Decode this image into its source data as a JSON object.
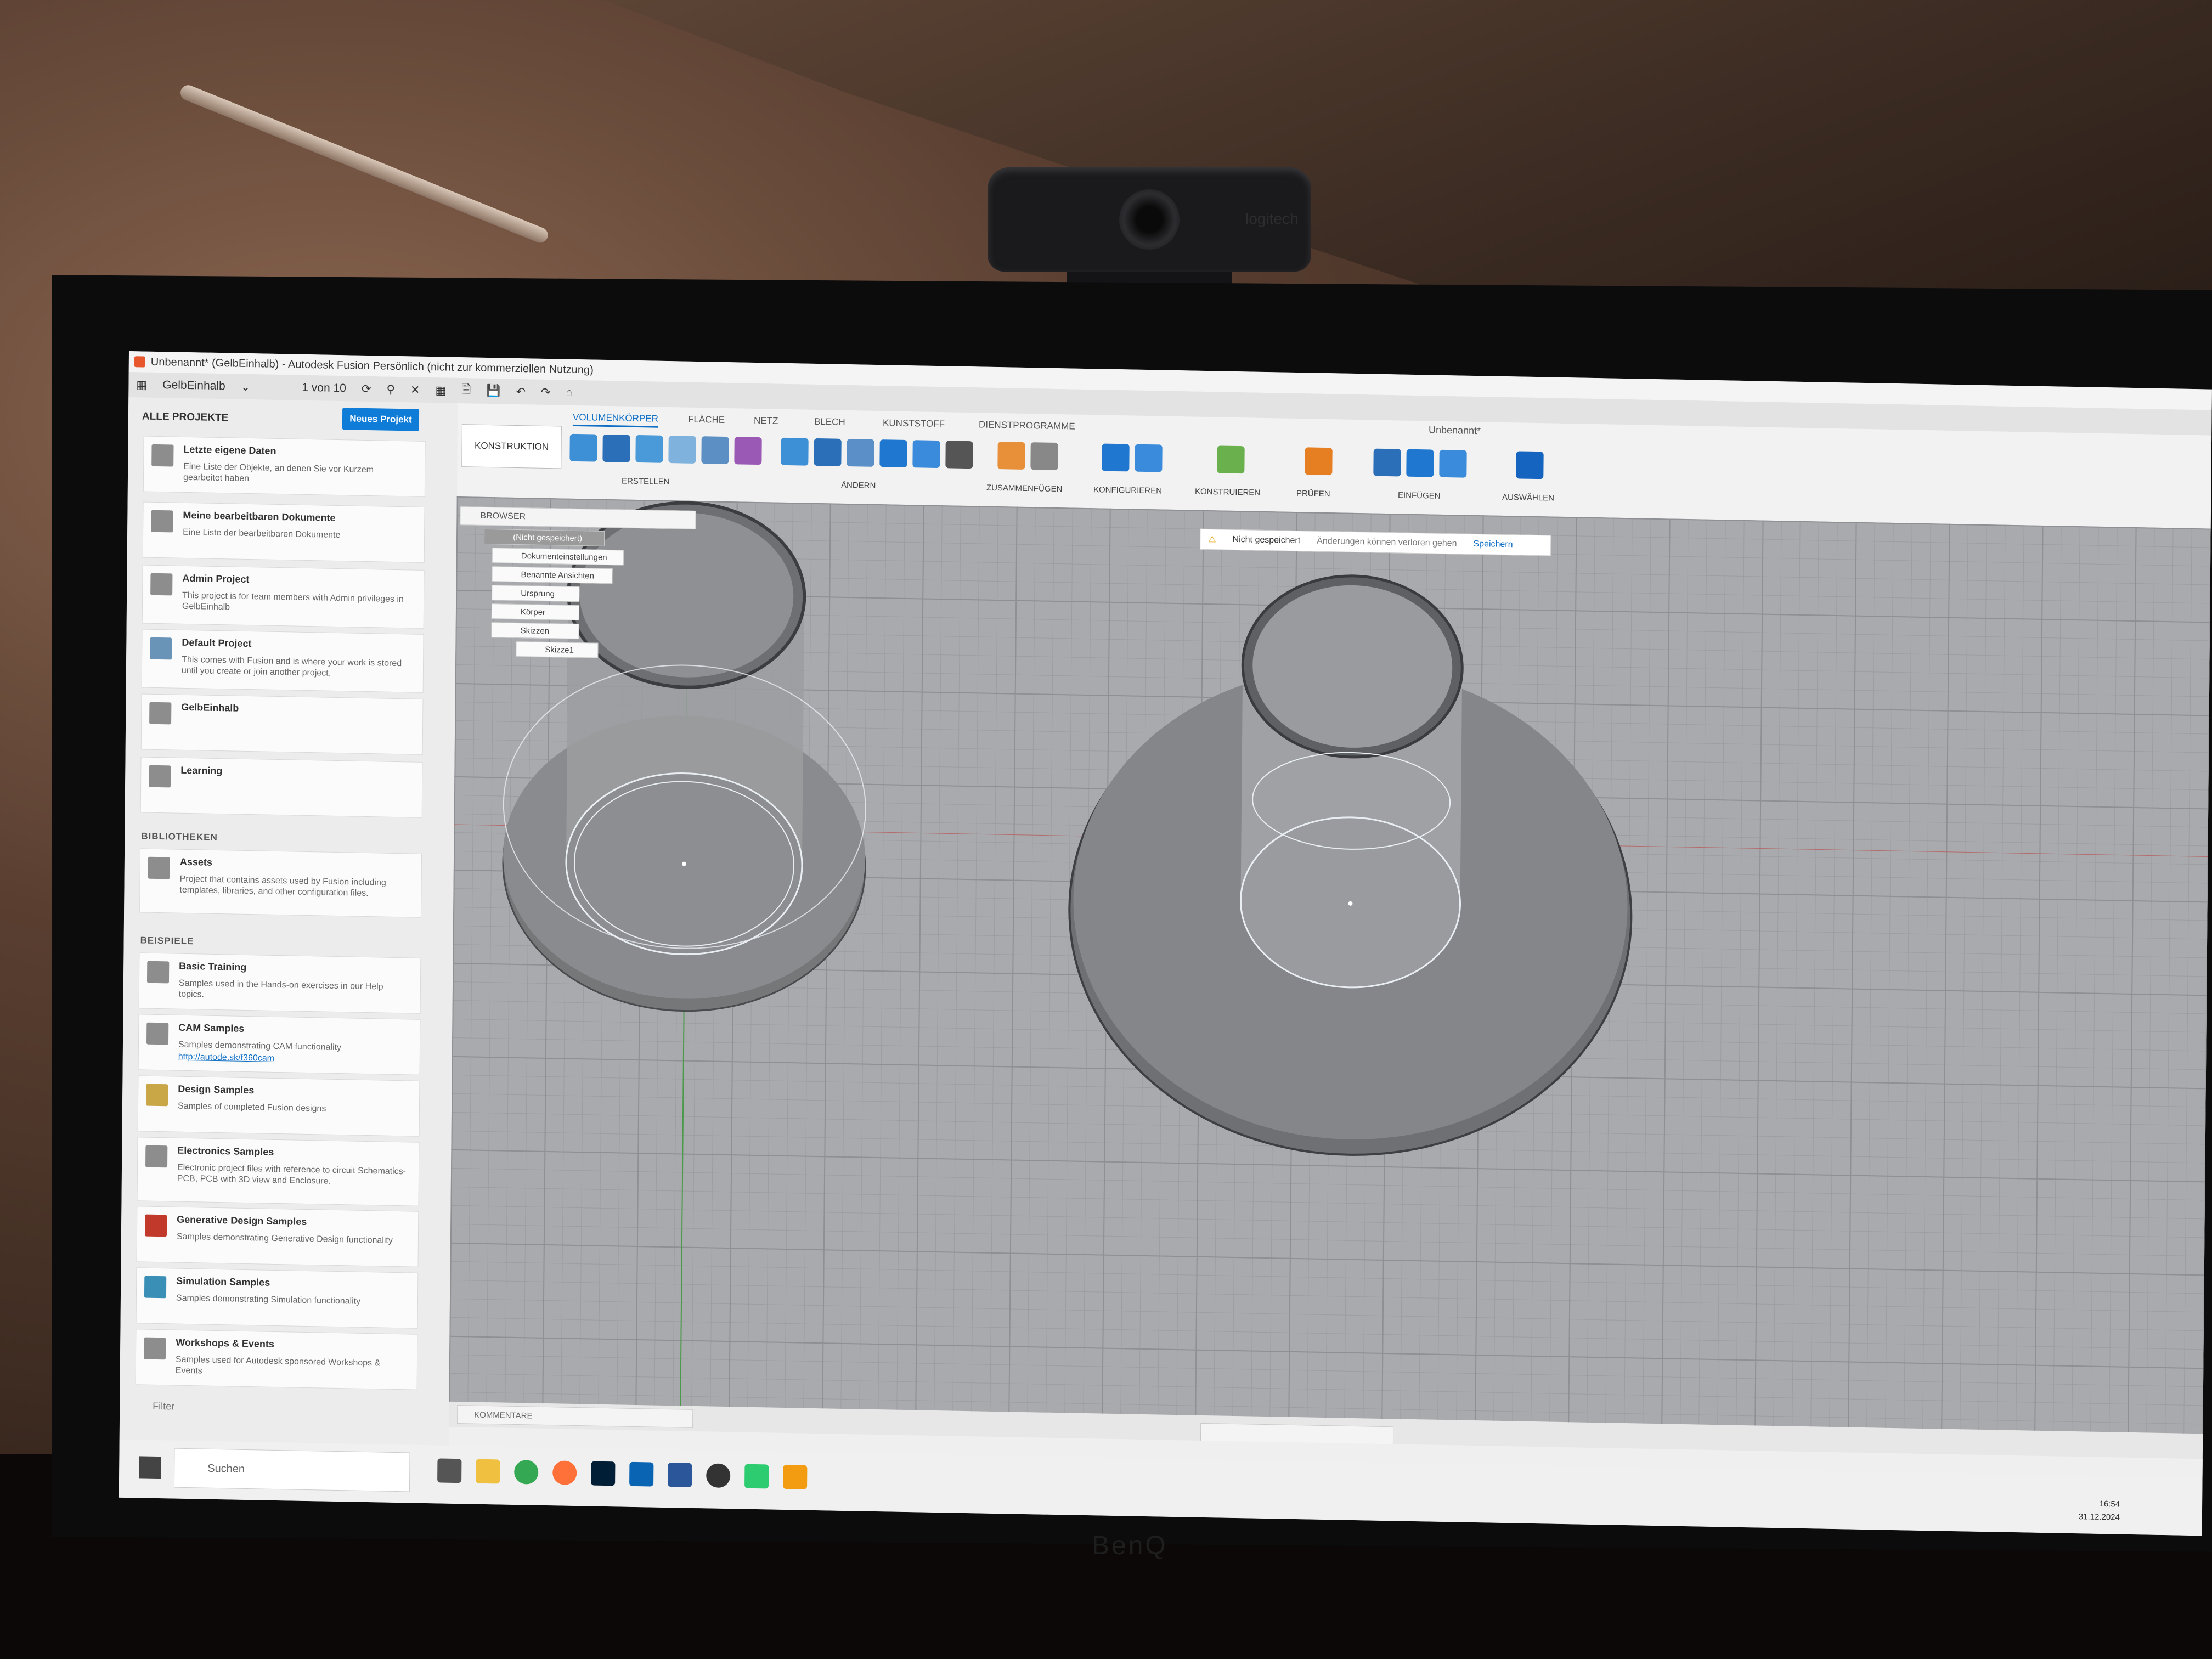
{
  "window": {
    "title": "Unbenannt* (GelbEinhalb) - Autodesk Fusion Persönlich (nicht zur kommerziellen Nutzung)"
  },
  "app_toolbar": {
    "team": "GelbEinhalb",
    "page_count": "1 von 10"
  },
  "data_panel": {
    "header": "ALLE PROJEKTE",
    "new_project": "Neues Projekt",
    "projects": [
      {
        "title": "Letzte eigene Daten",
        "desc": "Eine Liste der Objekte, an denen Sie vor Kurzem gearbeitet haben"
      },
      {
        "title": "Meine bearbeitbaren Dokumente",
        "desc": "Eine Liste der bearbeitbaren Dokumente"
      },
      {
        "title": "Admin Project",
        "desc": "This project is for team members with Admin privileges in GelbEinhalb"
      },
      {
        "title": "Default Project",
        "desc": "This comes with Fusion and is where your work is stored until you create or join another project."
      },
      {
        "title": "GelbEinhalb",
        "desc": ""
      },
      {
        "title": "Learning",
        "desc": ""
      }
    ],
    "libraries_label": "BIBLIOTHEKEN",
    "libraries": [
      {
        "title": "Assets",
        "desc": "Project that contains assets used by Fusion including templates, libraries, and other configuration files."
      }
    ],
    "samples_label": "BEISPIELE",
    "samples": [
      {
        "title": "Basic Training",
        "desc": "Samples used in the Hands-on exercises in our Help topics."
      },
      {
        "title": "CAM Samples",
        "desc": "Samples demonstrating CAM functionality",
        "link": "http://autode.sk/f360cam"
      },
      {
        "title": "Design Samples",
        "desc": "Samples of completed Fusion designs"
      },
      {
        "title": "Electronics Samples",
        "desc": "Electronic project files with reference to circuit Schematics-PCB, PCB with 3D view and Enclosure."
      },
      {
        "title": "Generative Design Samples",
        "desc": "Samples demonstrating Generative Design functionality"
      },
      {
        "title": "Simulation Samples",
        "desc": "Samples demonstrating Simulation functionality"
      },
      {
        "title": "Workshops & Events",
        "desc": "Samples used for Autodesk sponsored Workshops & Events"
      }
    ],
    "filter": "Filter"
  },
  "ribbon": {
    "workspace": "KONSTRUKTION",
    "document_title": "Unbenannt*",
    "tabs": [
      "VOLUMENKÖRPER",
      "FLÄCHE",
      "NETZ",
      "BLECH",
      "KUNSTSTOFF",
      "DIENSTPROGRAMME"
    ],
    "groups": [
      "ERSTELLEN",
      "ÄNDERN",
      "ZUSAMMENFÜGEN",
      "KONFIGURIEREN",
      "KONSTRUIEREN",
      "PRÜFEN",
      "EINFÜGEN",
      "AUSWÄHLEN"
    ]
  },
  "browser": {
    "header": "BROWSER",
    "nodes": [
      "(Nicht gespeichert)",
      "Dokumenteinstellungen",
      "Benannte Ansichten",
      "Ursprung",
      "Körper",
      "Skizzen",
      "Skizze1"
    ]
  },
  "notice": {
    "status": "Nicht gespeichert",
    "message": "Änderungen können verloren gehen",
    "action": "Speichern"
  },
  "comments": {
    "label": "KOMMENTARE"
  },
  "taskbar": {
    "search": "Suchen",
    "time": "16:54",
    "date": "31.12.2024"
  },
  "webcam": {
    "brand": "logitech"
  },
  "monitor": {
    "brand": "BenQ"
  }
}
